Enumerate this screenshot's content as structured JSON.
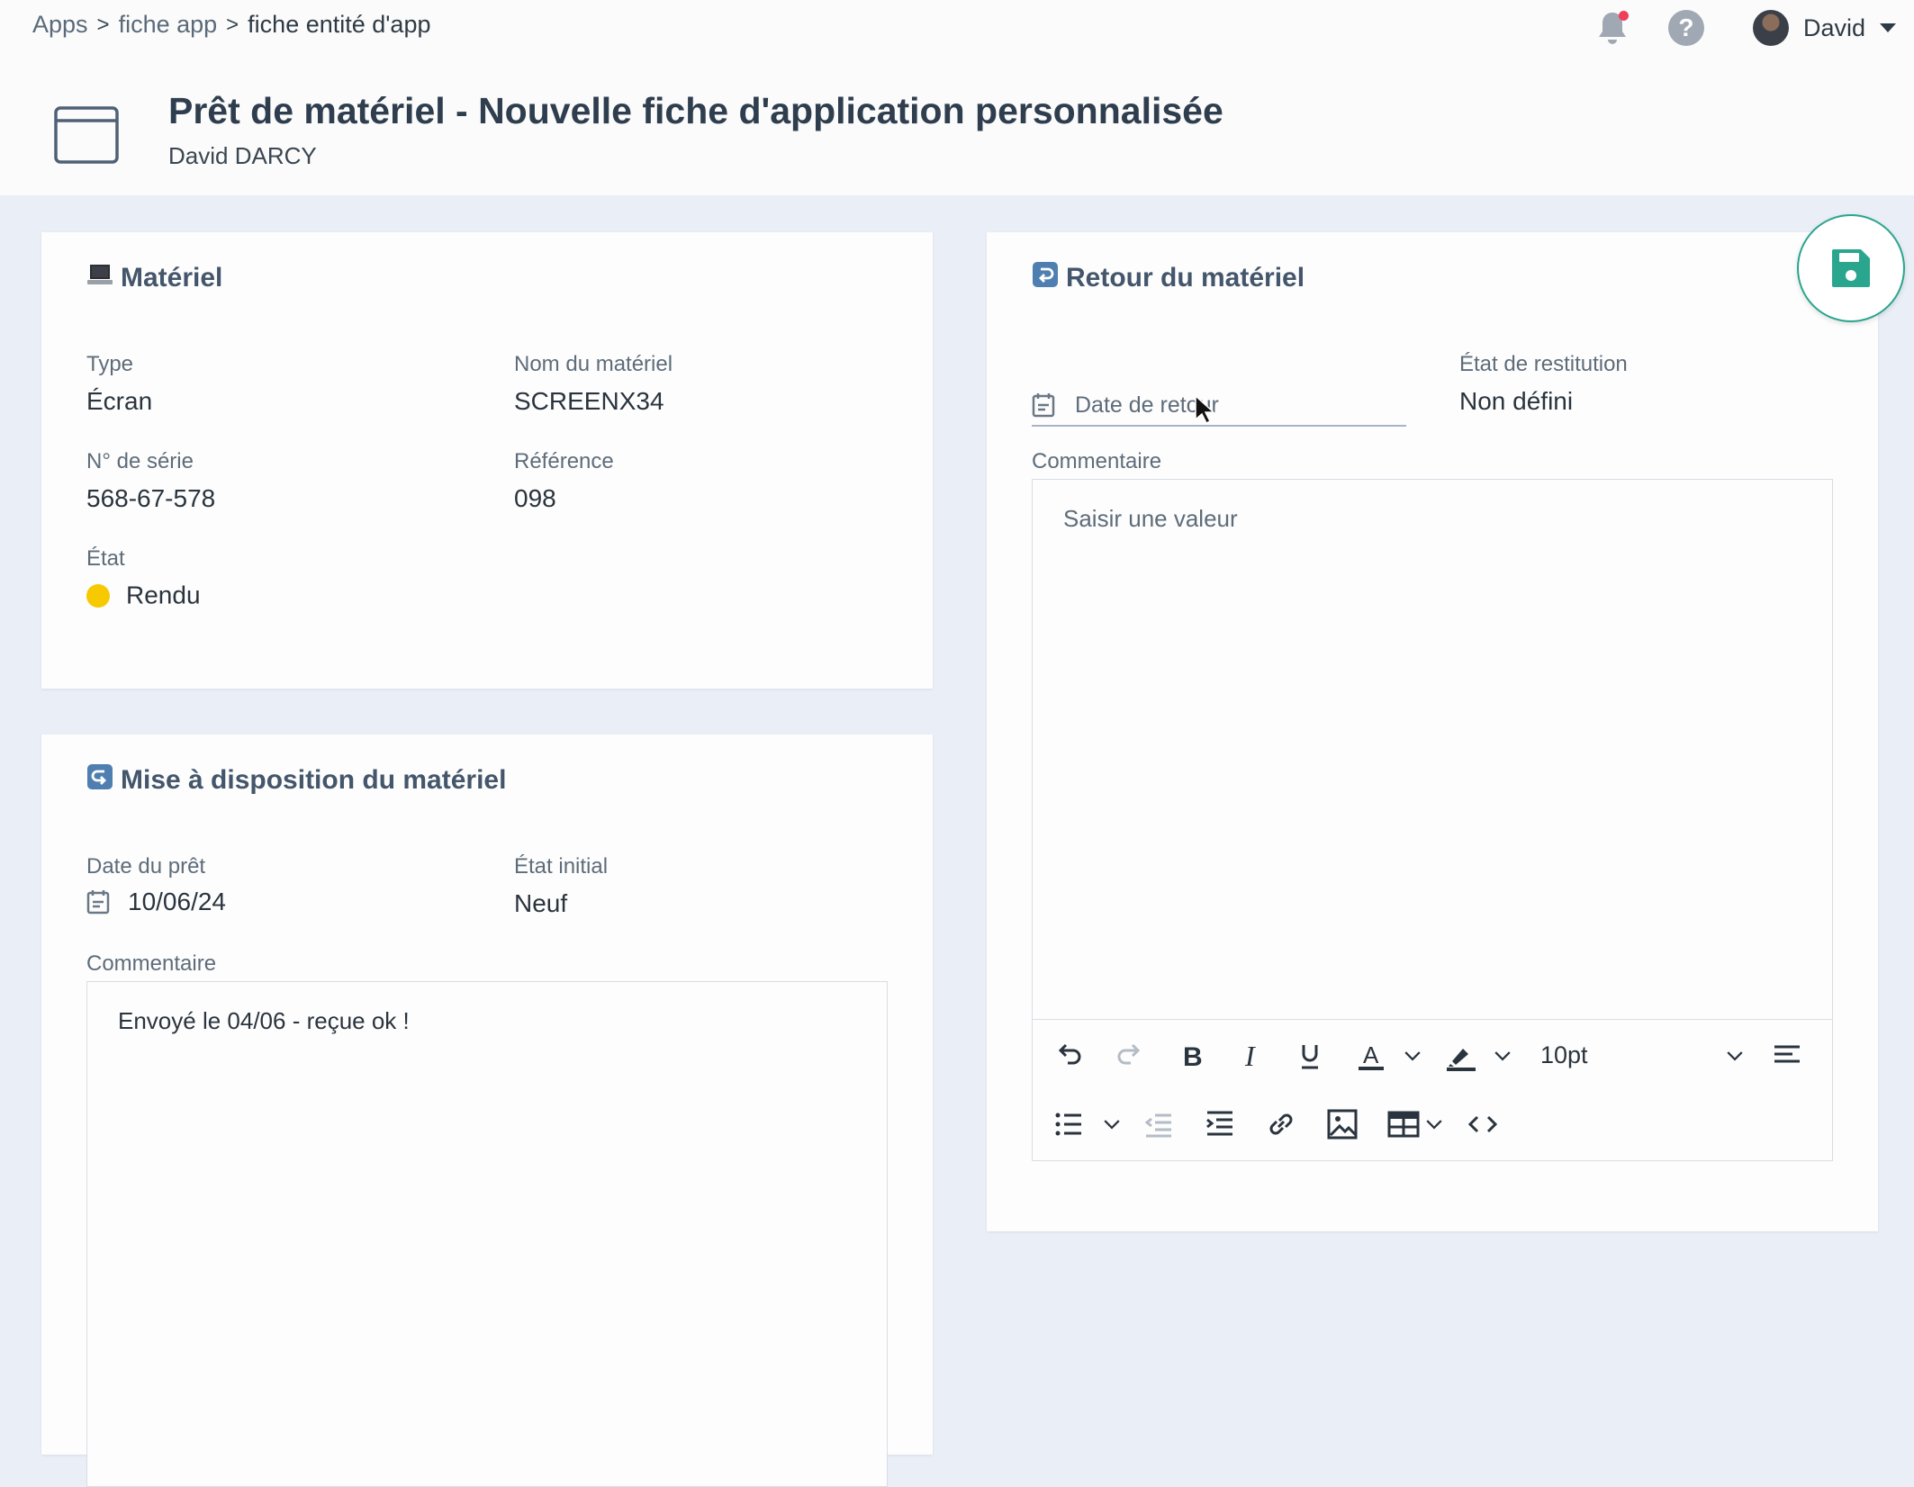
{
  "breadcrumb": {
    "items": [
      "Apps",
      "fiche app",
      "fiche entité d'app"
    ],
    "separator": ">"
  },
  "header": {
    "title": "Prêt de matériel - Nouvelle fiche d'application personnalisée",
    "subtitle": "David DARCY",
    "user_name": "David",
    "help_glyph": "?",
    "notification_badge_color": "#ef3f5a"
  },
  "materiel": {
    "title": "Matériel",
    "icon": "laptop-emoji",
    "type_label": "Type",
    "type_value": "Écran",
    "nom_label": "Nom du matériel",
    "nom_value": "SCREENX34",
    "serie_label": "N° de série",
    "serie_value": "568-67-578",
    "reference_label": "Référence",
    "reference_value": "098",
    "etat_label": "État",
    "etat_value": "Rendu",
    "etat_color": "#f7c900"
  },
  "mise_a_disposition": {
    "title": "Mise à disposition du matériel",
    "icon": "arrow-curving-right-emoji",
    "date_label": "Date du prêt",
    "date_value": "10/06/24",
    "etat_initial_label": "État initial",
    "etat_initial_value": "Neuf",
    "commentaire_label": "Commentaire",
    "commentaire_value": "Envoyé le 04/06 - reçue ok !"
  },
  "retour": {
    "title": "Retour du matériel",
    "icon": "arrow-curving-left-emoji",
    "date_placeholder": "Date de retour",
    "etat_restitution_label": "État de restitution",
    "etat_restitution_value": "Non défini",
    "commentaire_label": "Commentaire",
    "commentaire_placeholder": "Saisir une valeur",
    "font_size": "10pt"
  },
  "colors": {
    "accent_save": "#2aa58e",
    "page_bg": "#eaeef6"
  }
}
